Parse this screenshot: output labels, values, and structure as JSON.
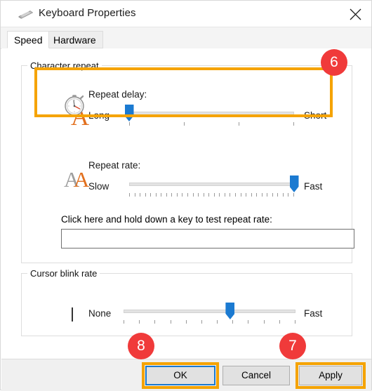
{
  "window": {
    "title": "Keyboard Properties",
    "icon": "keyboard-icon",
    "close_label": "✕"
  },
  "tabs": [
    {
      "label": "Speed",
      "active": true
    },
    {
      "label": "Hardware",
      "active": false
    }
  ],
  "groups": {
    "character_repeat": {
      "legend": "Character repeat",
      "repeat_delay": {
        "label": "Repeat delay:",
        "icon": "stopwatch-letter-a-icon",
        "min_label": "Long",
        "max_label": "Short",
        "value_percent": 0,
        "tick_count": 4
      },
      "repeat_rate": {
        "label": "Repeat rate:",
        "icon": "double-letter-a-icon",
        "min_label": "Slow",
        "max_label": "Fast",
        "value_percent": 100,
        "tick_count": 32
      },
      "test": {
        "label": "Click here and hold down a key to test repeat rate:",
        "value": "",
        "placeholder": ""
      }
    },
    "cursor_blink_rate": {
      "legend": "Cursor blink rate",
      "icon": "text-caret-icon",
      "min_label": "None",
      "max_label": "Fast",
      "value_percent": 62,
      "tick_count": 12
    }
  },
  "footer": {
    "ok_label": "OK",
    "cancel_label": "Cancel",
    "apply_label": "Apply"
  },
  "annotations": {
    "badge_6": "6",
    "badge_7": "7",
    "badge_8": "8",
    "highlight_color": "#f5a300",
    "badge_color": "#f03a3a",
    "accent_color": "#1b7ad1"
  }
}
